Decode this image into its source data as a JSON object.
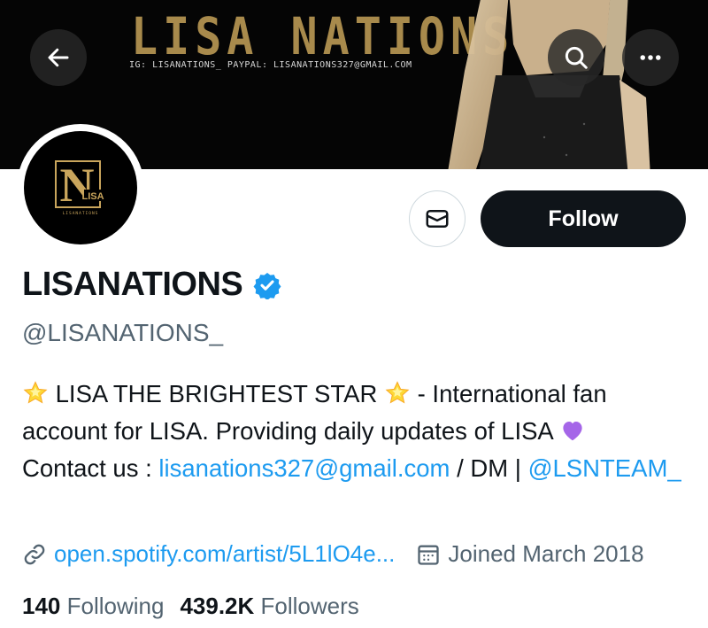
{
  "banner": {
    "title": "LISA NATIONS",
    "subtitle": "IG: LISANATIONS_  PAYPAL: LISANATIONS327@GMAIL.COM"
  },
  "header": {
    "back_icon": "arrow-left-icon",
    "search_icon": "search-icon",
    "more_icon": "more-horizontal-icon"
  },
  "avatar": {
    "logo_letter": "N",
    "logo_word": "LISA",
    "logo_small": "LISANATIONS"
  },
  "actions": {
    "message_icon": "envelope-icon",
    "follow_label": "Follow"
  },
  "profile": {
    "display_name": "LISANATIONS",
    "verified_icon": "verified-badge-icon",
    "handle": "@LISANATIONS_"
  },
  "bio": {
    "part1": " LISA THE BRIGHTEST STAR ",
    "part2": " - International fan account for LISA. Providing daily updates of LISA ",
    "part3": " Contact us : ",
    "email": "lisanations327@gmail.com",
    "part4": " / DM | ",
    "mention": "@LSNTEAM_",
    "emoji_star": "glowing-star-emoji",
    "emoji_heart": "purple-heart-emoji"
  },
  "meta": {
    "url_icon": "link-icon",
    "url": "open.spotify.com/artist/5L1lO4e...",
    "calendar_icon": "calendar-icon",
    "joined": "Joined March 2018"
  },
  "counts": {
    "following_value": "140",
    "following_label": "Following",
    "followers_value": "439.2K",
    "followers_label": "Followers"
  },
  "colors": {
    "accent": "#1d9bf0",
    "text": "#0f1419",
    "secondary": "#536471",
    "banner_gold": "#a88a4c",
    "follow_bg": "#0f1419"
  }
}
